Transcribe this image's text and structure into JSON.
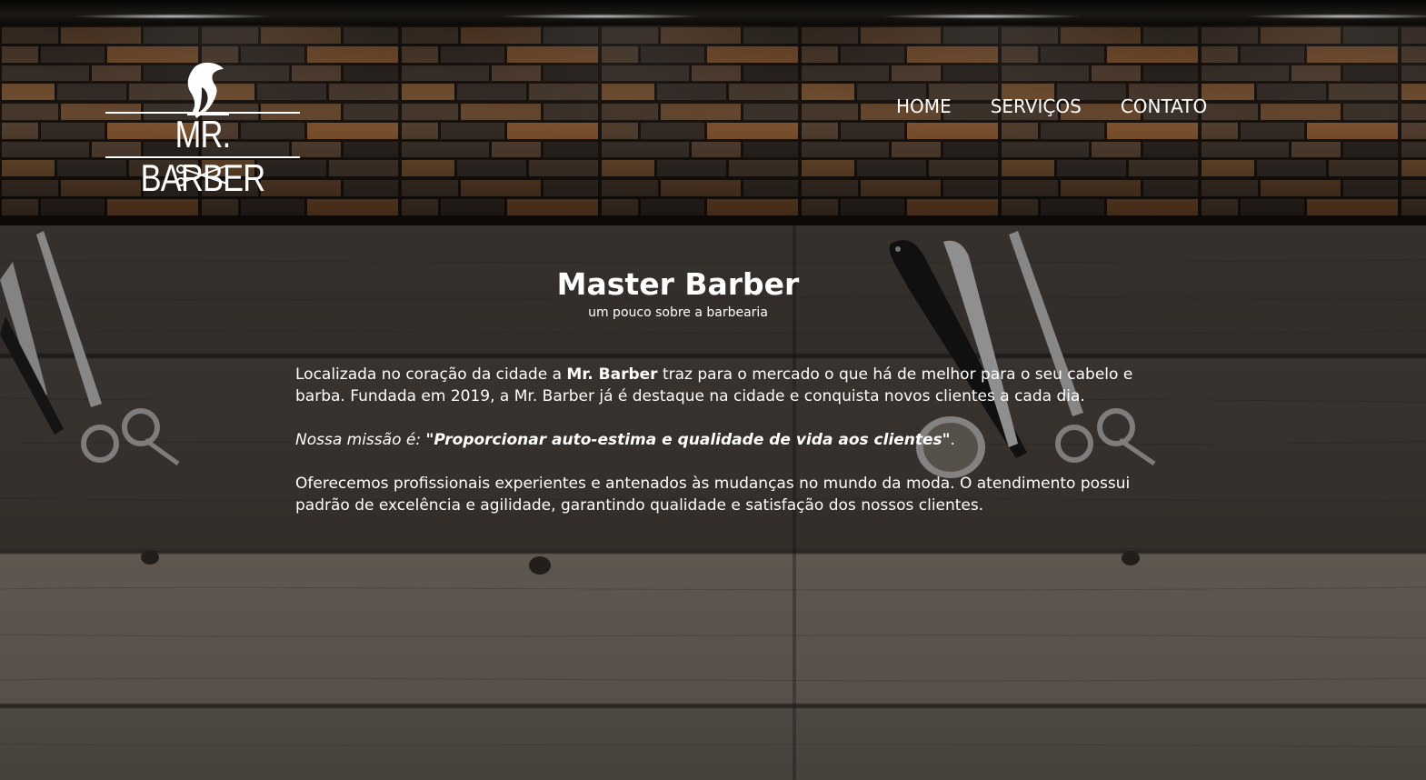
{
  "header": {
    "logo": {
      "text": "MR. BARBER",
      "icon": "barber-head-icon",
      "scissors_icon": "crossed-scissors-icon"
    },
    "nav": [
      {
        "label": "HOME"
      },
      {
        "label": "SERVIÇOS"
      },
      {
        "label": "CONTATO"
      }
    ]
  },
  "main": {
    "title": "Master Barber",
    "subtitle": "um pouco sobre a barbearia",
    "p1_a": "Localizada no coração da cidade a ",
    "p1_strong": "Mr. Barber",
    "p1_b": " traz para o mercado o que há de melhor para o seu cabelo e barba. Fundada em 2019, a Mr. Barber já é destaque na cidade e conquista novos clientes a cada dia.",
    "p2_label": "Nossa missão é: ",
    "p2_quote": "\"Proporcionar auto-estima e qualidade de vida aos clientes\"",
    "p2_end": ".",
    "p3": "Oferecemos profissionais experientes e antenados às mudanças no mundo da moda. O atendimento possui padrão de excelência e agilidade, garantindo qualidade e satisfação dos nossos clientes."
  },
  "colors": {
    "text": "#ffffff",
    "wood": "#534c45",
    "header_dark": "#0b0a09"
  }
}
